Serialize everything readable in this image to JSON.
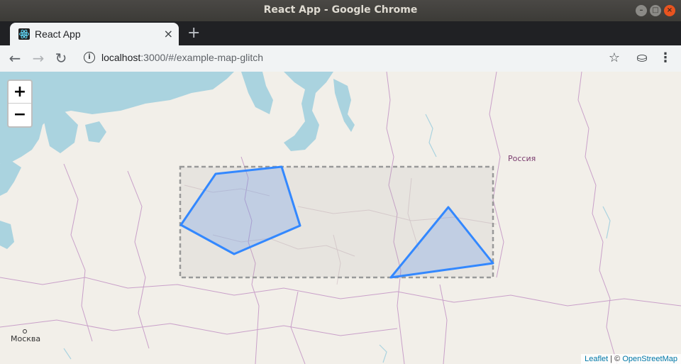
{
  "window": {
    "title": "React App - Google Chrome"
  },
  "tab": {
    "label": "React App",
    "close": "×",
    "new_tab": "+"
  },
  "toolbar": {
    "url_host": "localhost",
    "url_rest": ":3000/#/example-map-glitch",
    "info_icon": "i"
  },
  "map": {
    "zoom_in": "+",
    "zoom_out": "−",
    "labels": {
      "country": "Россия",
      "city": "Москва"
    },
    "attribution": {
      "leaflet": "Leaflet",
      "separator": " | © ",
      "osm": "OpenStreetMap"
    },
    "colors": {
      "water": "#aad3df",
      "land": "#f2efe9",
      "polygon_stroke": "#3388ff",
      "polygon_fill": "#a8c2ee",
      "boundary": "#c9a0c9"
    }
  }
}
